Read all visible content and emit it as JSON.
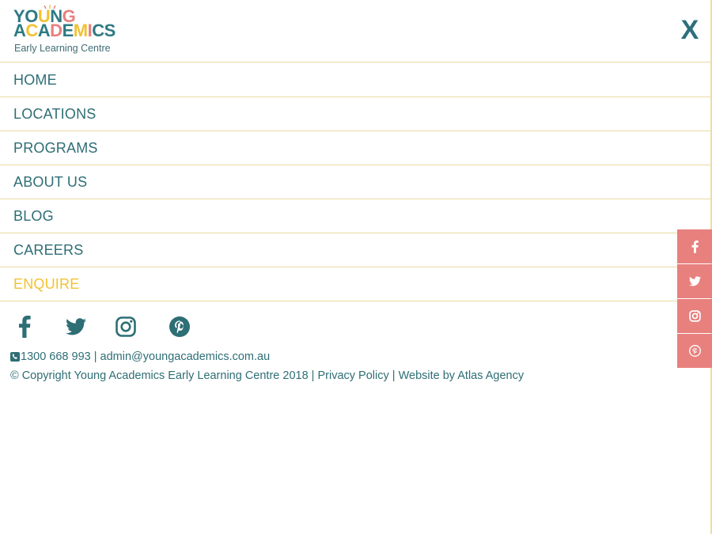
{
  "brand": {
    "logo_line1": "YOUNG",
    "logo_line2": "ACADEMICS",
    "logo_sub": "Early Learning Centre",
    "colors": {
      "teal": "#2e6e75",
      "yellow": "#f2c233",
      "coral": "#e8807e",
      "divider": "#ead9a4"
    }
  },
  "header": {
    "close_label": "X",
    "close_icon": "close-icon"
  },
  "menu": {
    "items": [
      {
        "label": "HOME"
      },
      {
        "label": "LOCATIONS"
      },
      {
        "label": "PROGRAMS"
      },
      {
        "label": "ABOUT US"
      },
      {
        "label": "BLOG"
      },
      {
        "label": "CAREERS"
      },
      {
        "label": "ENQUIRE",
        "highlighted": true
      }
    ]
  },
  "social": {
    "icons": [
      "facebook-icon",
      "twitter-icon",
      "instagram-icon",
      "pinterest-icon"
    ]
  },
  "footer": {
    "phone": "1300 668 993",
    "separator": "|",
    "email": "admin@youngacademics.com.au",
    "copyright": "© Copyright Young Academics Early Learning Centre 2018",
    "privacy": "Privacy Policy",
    "credit": "Website by Atlas Agency"
  },
  "side_share": {
    "icons": [
      "facebook-icon",
      "twitter-icon",
      "instagram-icon",
      "pinterest-icon"
    ]
  }
}
